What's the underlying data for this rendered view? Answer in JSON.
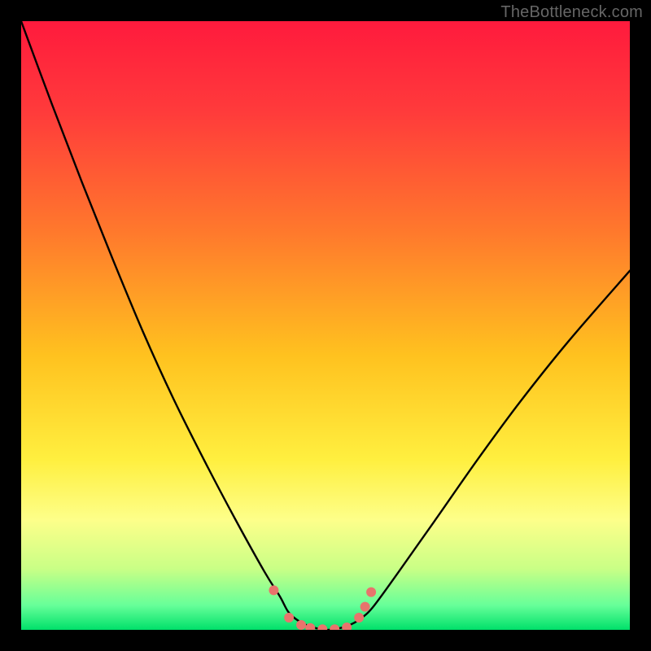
{
  "watermark": "TheBottleneck.com",
  "colors": {
    "black": "#000000",
    "curve": "#000000",
    "marker_fill": "#e8746c",
    "gradient_stops": [
      {
        "offset": 0.0,
        "color": "#ff1a3d"
      },
      {
        "offset": 0.15,
        "color": "#ff3b3b"
      },
      {
        "offset": 0.35,
        "color": "#ff7a2c"
      },
      {
        "offset": 0.55,
        "color": "#ffc21f"
      },
      {
        "offset": 0.72,
        "color": "#ffef3f"
      },
      {
        "offset": 0.82,
        "color": "#fdff8a"
      },
      {
        "offset": 0.9,
        "color": "#c9ff86"
      },
      {
        "offset": 0.96,
        "color": "#66ff99"
      },
      {
        "offset": 1.0,
        "color": "#00e06a"
      }
    ]
  },
  "chart_data": {
    "type": "line",
    "title": "",
    "xlabel": "",
    "ylabel": "",
    "xlim": [
      0,
      1
    ],
    "ylim": [
      0,
      1
    ],
    "grid": false,
    "legend": false,
    "series": [
      {
        "name": "bottleneck-curve",
        "x": [
          0.0,
          0.05,
          0.1,
          0.15,
          0.2,
          0.25,
          0.3,
          0.35,
          0.4,
          0.425,
          0.44,
          0.46,
          0.48,
          0.5,
          0.52,
          0.54,
          0.56,
          0.58,
          0.62,
          0.68,
          0.75,
          0.82,
          0.9,
          1.0
        ],
        "y": [
          1.0,
          0.865,
          0.735,
          0.61,
          0.49,
          0.38,
          0.28,
          0.185,
          0.095,
          0.055,
          0.028,
          0.012,
          0.004,
          0.0,
          0.002,
          0.008,
          0.02,
          0.04,
          0.095,
          0.18,
          0.28,
          0.375,
          0.475,
          0.59
        ]
      }
    ],
    "markers": {
      "name": "bottom-cluster",
      "x": [
        0.415,
        0.44,
        0.46,
        0.475,
        0.495,
        0.515,
        0.535,
        0.555,
        0.565,
        0.575
      ],
      "y": [
        0.065,
        0.02,
        0.008,
        0.003,
        0.001,
        0.001,
        0.004,
        0.02,
        0.038,
        0.062
      ],
      "r": 6
    }
  }
}
